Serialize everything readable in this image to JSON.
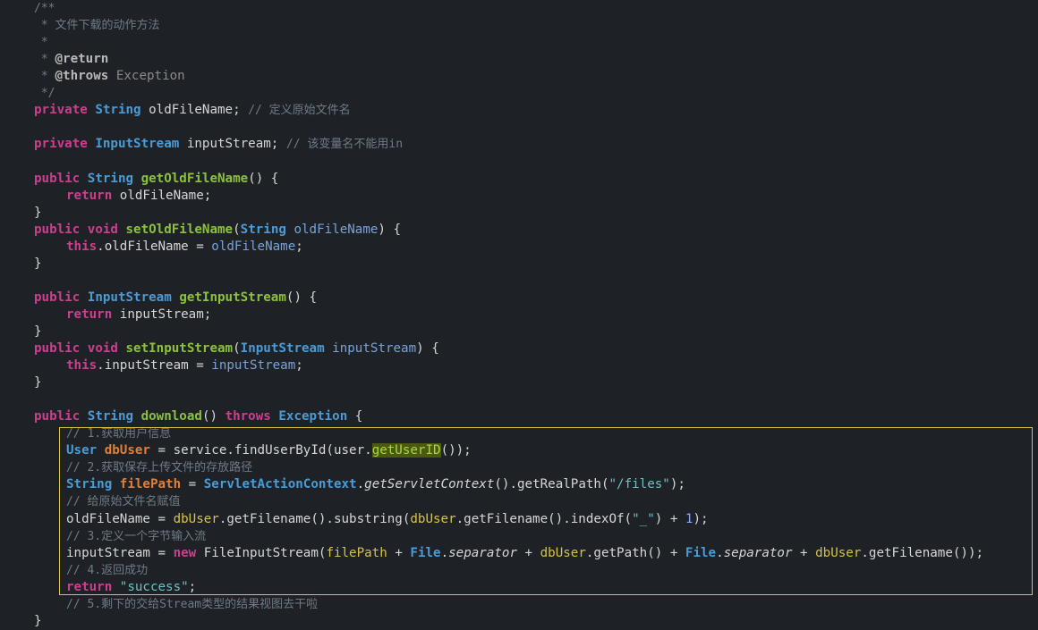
{
  "editor": {
    "lines": [
      {
        "name": "line-javadoc-open",
        "indent": 1,
        "tokens": [
          [
            "/**",
            "comment"
          ]
        ]
      },
      {
        "name": "line-javadoc-desc",
        "indent": 1,
        "tokens": [
          [
            " * ",
            "comment"
          ],
          [
            "文件下载的动作方法",
            "comment"
          ]
        ]
      },
      {
        "name": "line-javadoc-empty",
        "indent": 1,
        "tokens": [
          [
            " *",
            "comment"
          ]
        ]
      },
      {
        "name": "line-javadoc-return",
        "indent": 1,
        "tokens": [
          [
            " * ",
            "comment"
          ],
          [
            "@return",
            "tag"
          ]
        ]
      },
      {
        "name": "line-javadoc-throws",
        "indent": 1,
        "tokens": [
          [
            " * ",
            "comment"
          ],
          [
            "@throws",
            "tag"
          ],
          [
            " Exception",
            "commenttype"
          ]
        ]
      },
      {
        "name": "line-javadoc-close",
        "indent": 1,
        "tokens": [
          [
            " */",
            "comment"
          ]
        ]
      },
      {
        "name": "line-field-oldfilename",
        "indent": 1,
        "tokens": [
          [
            "private",
            "kw"
          ],
          [
            " ",
            "plain"
          ],
          [
            "String",
            "type"
          ],
          [
            " oldFileName; ",
            "field"
          ],
          [
            "// 定义原始文件名",
            "comment"
          ]
        ]
      },
      {
        "name": "line-blank",
        "indent": 0,
        "tokens": []
      },
      {
        "name": "line-field-inputstream",
        "indent": 1,
        "tokens": [
          [
            "private",
            "kw"
          ],
          [
            " ",
            "plain"
          ],
          [
            "InputStream",
            "type"
          ],
          [
            " inputStream; ",
            "field"
          ],
          [
            "// 该变量名不能用in",
            "comment"
          ]
        ]
      },
      {
        "name": "line-blank",
        "indent": 0,
        "tokens": []
      },
      {
        "name": "line-getter-oldfilename",
        "indent": 1,
        "tokens": [
          [
            "public",
            "kw"
          ],
          [
            " ",
            "plain"
          ],
          [
            "String",
            "type"
          ],
          [
            " ",
            "plain"
          ],
          [
            "getOldFileName",
            "method"
          ],
          [
            "() {",
            "plain"
          ]
        ]
      },
      {
        "name": "line-return-oldfilename",
        "indent": 2,
        "tokens": [
          [
            "return",
            "kw"
          ],
          [
            " oldFileName;",
            "field"
          ]
        ]
      },
      {
        "name": "line-close-brace",
        "indent": 1,
        "tokens": [
          [
            "}",
            "plain"
          ]
        ]
      },
      {
        "name": "line-setter-oldfilename",
        "indent": 1,
        "tokens": [
          [
            "public",
            "kw"
          ],
          [
            " ",
            "plain"
          ],
          [
            "void",
            "kw"
          ],
          [
            " ",
            "plain"
          ],
          [
            "setOldFileName",
            "method"
          ],
          [
            "(",
            "plain"
          ],
          [
            "String",
            "type"
          ],
          [
            " ",
            "plain"
          ],
          [
            "oldFileName",
            "param"
          ],
          [
            ") {",
            "plain"
          ]
        ]
      },
      {
        "name": "line-assign-oldfilename",
        "indent": 2,
        "tokens": [
          [
            "this",
            "kw"
          ],
          [
            ".oldFileName = ",
            "field"
          ],
          [
            "oldFileName",
            "param"
          ],
          [
            ";",
            "plain"
          ]
        ]
      },
      {
        "name": "line-close-brace",
        "indent": 1,
        "tokens": [
          [
            "}",
            "plain"
          ]
        ]
      },
      {
        "name": "line-blank",
        "indent": 0,
        "tokens": []
      },
      {
        "name": "line-getter-inputstream",
        "indent": 1,
        "tokens": [
          [
            "public",
            "kw"
          ],
          [
            " ",
            "plain"
          ],
          [
            "InputStream",
            "type"
          ],
          [
            " ",
            "plain"
          ],
          [
            "getInputStream",
            "method"
          ],
          [
            "() {",
            "plain"
          ]
        ]
      },
      {
        "name": "line-return-inputstream",
        "indent": 2,
        "tokens": [
          [
            "return",
            "kw"
          ],
          [
            " inputStream;",
            "field"
          ]
        ]
      },
      {
        "name": "line-close-brace",
        "indent": 1,
        "tokens": [
          [
            "}",
            "plain"
          ]
        ]
      },
      {
        "name": "line-setter-inputstream",
        "indent": 1,
        "tokens": [
          [
            "public",
            "kw"
          ],
          [
            " ",
            "plain"
          ],
          [
            "void",
            "kw"
          ],
          [
            " ",
            "plain"
          ],
          [
            "setInputStream",
            "method"
          ],
          [
            "(",
            "plain"
          ],
          [
            "InputStream",
            "type"
          ],
          [
            " ",
            "plain"
          ],
          [
            "inputStream",
            "param"
          ],
          [
            ") {",
            "plain"
          ]
        ]
      },
      {
        "name": "line-assign-inputstream",
        "indent": 2,
        "tokens": [
          [
            "this",
            "kw"
          ],
          [
            ".inputStream = ",
            "field"
          ],
          [
            "inputStream",
            "param"
          ],
          [
            ";",
            "plain"
          ]
        ]
      },
      {
        "name": "line-close-brace",
        "indent": 1,
        "tokens": [
          [
            "}",
            "plain"
          ]
        ]
      },
      {
        "name": "line-blank",
        "indent": 0,
        "tokens": []
      },
      {
        "name": "line-download-signature",
        "indent": 1,
        "tokens": [
          [
            "public",
            "kw"
          ],
          [
            " ",
            "plain"
          ],
          [
            "String",
            "type"
          ],
          [
            " ",
            "plain"
          ],
          [
            "download",
            "method"
          ],
          [
            "() ",
            "plain"
          ],
          [
            "throws",
            "kw"
          ],
          [
            " ",
            "plain"
          ],
          [
            "Exception",
            "type"
          ],
          [
            " {",
            "plain"
          ]
        ]
      },
      {
        "name": "line-comment-step1",
        "indent": 2,
        "tokens": [
          [
            "// 1.获取用户信息",
            "comment"
          ]
        ]
      },
      {
        "name": "line-get-dbuser",
        "indent": 2,
        "tokens": [
          [
            "User",
            "type"
          ],
          [
            " ",
            "plain"
          ],
          [
            "dbUser",
            "localdecl"
          ],
          [
            " = service.findUserById(user.",
            "plain"
          ],
          [
            "getUserID",
            "highlight"
          ],
          [
            "());",
            "plain"
          ]
        ]
      },
      {
        "name": "line-comment-step2",
        "indent": 2,
        "tokens": [
          [
            "// 2.获取保存上传文件的存放路径",
            "comment"
          ]
        ]
      },
      {
        "name": "line-get-filepath",
        "indent": 2,
        "tokens": [
          [
            "String",
            "type"
          ],
          [
            " ",
            "plain"
          ],
          [
            "filePath",
            "localdecl"
          ],
          [
            " = ",
            "plain"
          ],
          [
            "ServletActionContext",
            "type"
          ],
          [
            ".",
            "plain"
          ],
          [
            "getServletContext",
            "static"
          ],
          [
            "().getRealPath(",
            "plain"
          ],
          [
            "\"/files\"",
            "string"
          ],
          [
            ");",
            "plain"
          ]
        ]
      },
      {
        "name": "line-comment-assign",
        "indent": 2,
        "tokens": [
          [
            "// 给原始文件名赋值",
            "comment"
          ]
        ]
      },
      {
        "name": "line-assign-filename",
        "indent": 2,
        "tokens": [
          [
            "oldFileName = ",
            "plain"
          ],
          [
            "dbUser",
            "localuse"
          ],
          [
            ".getFilename().substring(",
            "plain"
          ],
          [
            "dbUser",
            "localuse"
          ],
          [
            ".getFilename().indexOf(",
            "plain"
          ],
          [
            "\"_\"",
            "string"
          ],
          [
            ") + ",
            "plain"
          ],
          [
            "1",
            "number"
          ],
          [
            ");",
            "plain"
          ]
        ]
      },
      {
        "name": "line-comment-step3",
        "indent": 2,
        "tokens": [
          [
            "// 3.定义一个字节输入流",
            "comment"
          ]
        ]
      },
      {
        "name": "line-create-inputstream",
        "indent": 2,
        "tokens": [
          [
            "inputStream = ",
            "plain"
          ],
          [
            "new",
            "kw"
          ],
          [
            " FileInputStream(",
            "plain"
          ],
          [
            "filePath",
            "localuse"
          ],
          [
            " + ",
            "plain"
          ],
          [
            "File",
            "type"
          ],
          [
            ".",
            "plain"
          ],
          [
            "separator",
            "static"
          ],
          [
            " + ",
            "plain"
          ],
          [
            "dbUser",
            "localuse"
          ],
          [
            ".getPath() + ",
            "plain"
          ],
          [
            "File",
            "type"
          ],
          [
            ".",
            "plain"
          ],
          [
            "separator",
            "static"
          ],
          [
            " + ",
            "plain"
          ],
          [
            "dbUser",
            "localuse"
          ],
          [
            ".getFilename());",
            "plain"
          ]
        ]
      },
      {
        "name": "line-comment-step4",
        "indent": 2,
        "tokens": [
          [
            "// 4.返回成功",
            "comment"
          ]
        ]
      },
      {
        "name": "line-return-success",
        "indent": 2,
        "tokens": [
          [
            "return",
            "kw"
          ],
          [
            " ",
            "plain"
          ],
          [
            "\"success\"",
            "string"
          ],
          [
            ";",
            "plain"
          ]
        ]
      },
      {
        "name": "line-comment-step5",
        "indent": 2,
        "tokens": [
          [
            "// 5.剩下的交给Stream类型的结果视图去干啦",
            "comment"
          ]
        ]
      },
      {
        "name": "line-close-brace",
        "indent": 1,
        "tokens": [
          [
            "}",
            "plain"
          ]
        ]
      }
    ]
  },
  "colors": {
    "background": "#1e2226",
    "keyword": "#cc3f8e",
    "type": "#4a9bd6",
    "method": "#8dc13d",
    "string": "#6fc0c3",
    "comment": "#6e7b85",
    "selection_border": "#d8c440"
  }
}
